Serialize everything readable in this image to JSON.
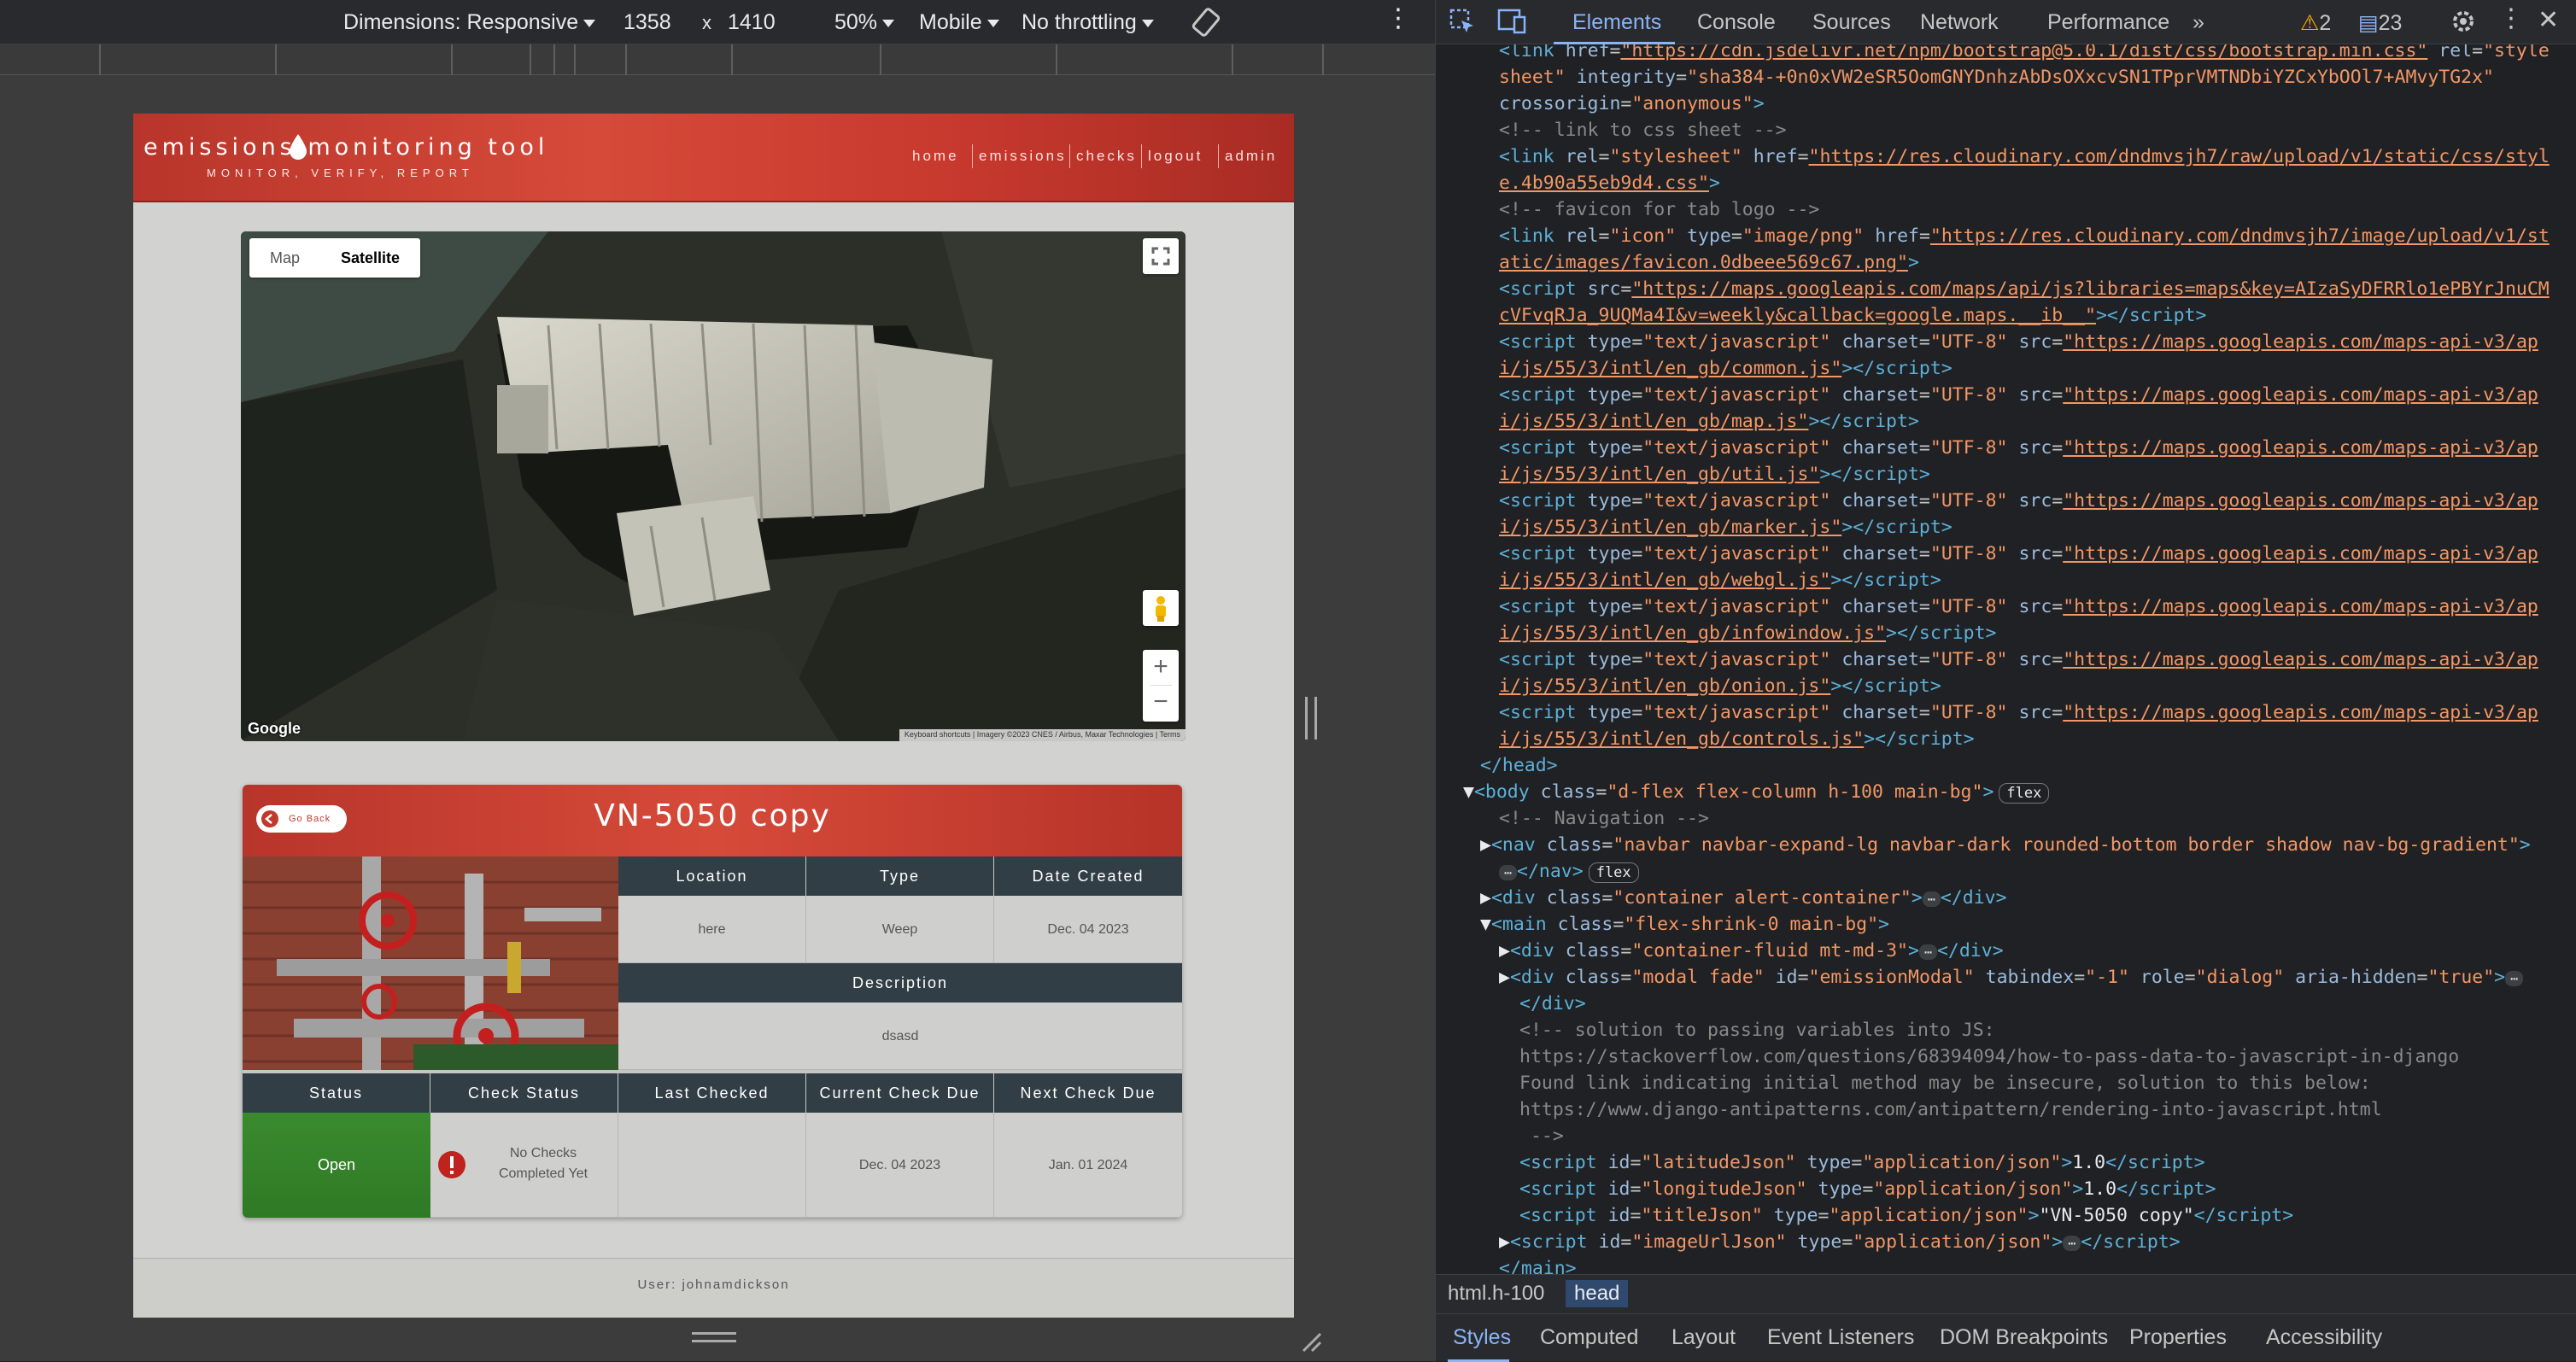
{
  "device_toolbar": {
    "dimensions": "Dimensions: Responsive",
    "width": "1358",
    "x": "x",
    "height": "1410",
    "zoom": "50%",
    "device": "Mobile",
    "throttling": "No throttling"
  },
  "site": {
    "brand": "emissions  monitoring tool",
    "tagline": "MONITOR, VERIFY, REPORT",
    "nav": [
      "home",
      "emissions",
      "checks",
      "logout",
      "admin"
    ]
  },
  "map": {
    "type_buttons": [
      "Map",
      "Satellite"
    ],
    "active_type": "Satellite",
    "google_label": "Google",
    "attribution": "Keyboard shortcuts  |  Imagery ©2023 CNES / Airbus, Maxar Technologies  |  Terms",
    "zoom_in": "+",
    "zoom_out": "−"
  },
  "emission": {
    "go_back": "Go Back",
    "title": "VN-5050 copy",
    "headers_top": [
      "Location",
      "Type",
      "Date Created"
    ],
    "values_top": [
      "here",
      "Weep",
      "Dec. 04 2023"
    ],
    "description_header": "Description",
    "description": "dsasd",
    "headers_bottom": [
      "Status",
      "Check Status",
      "Last Checked",
      "Current Check Due",
      "Next Check Due"
    ],
    "status": "Open",
    "check_status_line1": "No Checks",
    "check_status_line2": "Completed Yet",
    "last_checked": "",
    "current_check_due": "Dec. 04 2023",
    "next_check_due": "Jan. 01 2024"
  },
  "footer": {
    "user": "User: johnamdickson"
  },
  "devtools": {
    "tabs": [
      "Elements",
      "Console",
      "Sources",
      "Network",
      "Performance",
      "»"
    ],
    "warnings": "2",
    "messages": "23",
    "breadcrumb": [
      "html.h-100",
      "head"
    ],
    "bottom_tabs": [
      "Styles",
      "Computed",
      "Layout",
      "Event Listeners",
      "DOM Breakpoints",
      "Properties",
      "Accessibility"
    ]
  }
}
